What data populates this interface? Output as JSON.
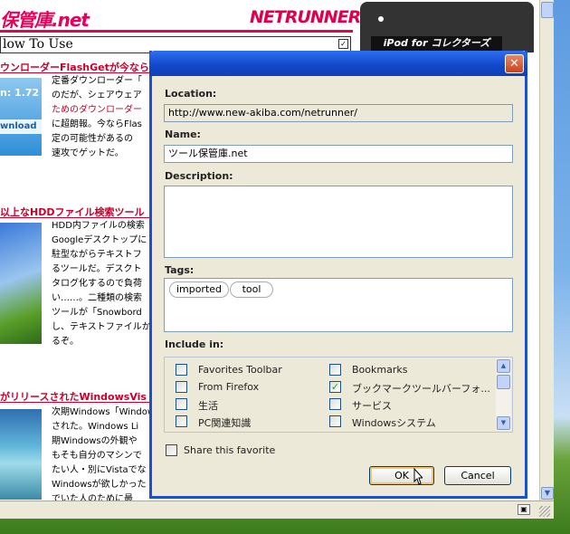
{
  "webpage": {
    "logo": "保管庫.net",
    "brand": "NETRUNNER",
    "howto": "low To Use",
    "sidebar_banner": "iPod for コレクターズ",
    "articles": [
      {
        "heading": "ウンローダーFlashGetが今なら",
        "thumb_version": "n: 1.72",
        "thumb_label": "wnload",
        "lines": [
          "定番ダウンローダー「",
          "のだが、シェアウェア",
          "ためのダウンローダー",
          "に超朗報。今ならFlas",
          "定の可能性があるの",
          "速攻でゲットだ。"
        ]
      },
      {
        "heading": "以上なHDDファイル検索ツール",
        "lines": [
          "HDD内ファイルの検索",
          "Googleデスクトップに",
          "駐型ながらテキストフ",
          "るツールだ。デスクト",
          "タログ化するので負荷",
          "い……。二種類の検索",
          "ツールが「Snowbord",
          "し、テキストファイルか",
          "るぞ。"
        ]
      },
      {
        "heading": "がリリースされたWindowsVis",
        "lines": [
          "次期Windows「Window",
          "された。Windows Li",
          "期Windowsの外観や",
          "もそも自分のマシンで",
          "たい人・別にVistaでな",
          "Windowsが欲しかった",
          "でいた人のために最"
        ]
      }
    ]
  },
  "dialog": {
    "close_symbol": "✕",
    "location_label": "Location:",
    "location_value": "http://www.new-akiba.com/netrunner/",
    "name_label": "Name:",
    "name_value": "ツール保管庫.net",
    "description_label": "Description:",
    "description_value": "",
    "tags_label": "Tags:",
    "tags": [
      "imported",
      "tool"
    ],
    "include_label": "Include in:",
    "include_items": [
      {
        "label": "Favorites Toolbar",
        "checked": false
      },
      {
        "label": "Bookmarks",
        "checked": false
      },
      {
        "label": "From Firefox",
        "checked": false
      },
      {
        "label": "ブックマークツールバーフォ...",
        "checked": true
      },
      {
        "label": "生活",
        "checked": false
      },
      {
        "label": "サービス",
        "checked": false
      },
      {
        "label": "PC関連知識",
        "checked": false
      },
      {
        "label": "Windowsシステム",
        "checked": false
      }
    ],
    "share_label": "Share this favorite",
    "share_checked": false,
    "ok_label": "OK",
    "cancel_label": "Cancel"
  },
  "colors": {
    "titlebar": "#1247c9",
    "dialog_bg": "#ece9d8",
    "accent_red": "#c8002a",
    "brand_pink": "#e5005a",
    "check_green": "#21a121"
  }
}
